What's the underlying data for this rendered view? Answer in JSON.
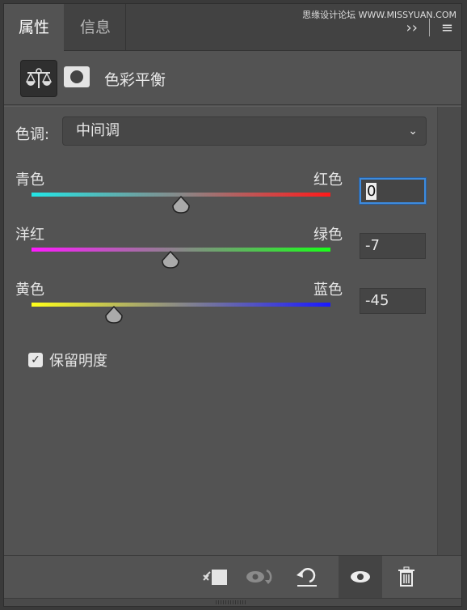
{
  "tabs": [
    {
      "label": "属性",
      "active": true
    },
    {
      "label": "信息",
      "active": false
    }
  ],
  "watermark": "思缘设计论坛 WWW.MISSYUAN.COM",
  "header": {
    "title": "色彩平衡",
    "icon": "balance-scale-icon",
    "mask_icon": "layer-mask-icon"
  },
  "tone": {
    "label": "色调:",
    "value": "中间调"
  },
  "sliders": [
    {
      "left": "青色",
      "right": "红色",
      "value": "0",
      "num": 0,
      "gradient": [
        "#23e6e6",
        "#ff1a1a"
      ]
    },
    {
      "left": "洋红",
      "right": "绿色",
      "value": "-7",
      "num": -7,
      "gradient": [
        "#ff1aff",
        "#1aff1a"
      ]
    },
    {
      "left": "黄色",
      "right": "蓝色",
      "value": "-45",
      "num": -45,
      "gradient": [
        "#ffff1a",
        "#1a1aff"
      ]
    }
  ],
  "slider_range": [
    -100,
    100
  ],
  "preserve_luminosity": {
    "label": "保留明度",
    "checked": true
  },
  "toolbar": [
    "clip-to-layer-icon",
    "view-previous-state-icon",
    "reset-icon",
    "visibility-eye-icon",
    "trash-icon"
  ],
  "accent": "#3d8bde"
}
